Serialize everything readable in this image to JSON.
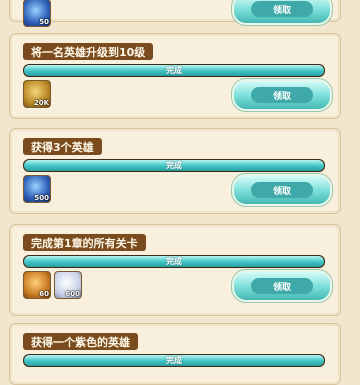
{
  "tasks": [
    {
      "title": "",
      "progress_label": "",
      "progress_fraction": 1.0,
      "button_label": "领取",
      "rewards": [
        {
          "icon": "blue-orb-icon",
          "count": "50"
        }
      ]
    },
    {
      "title": "将一名英雄升级到10级",
      "progress_label": "完成",
      "progress_fraction": 1.0,
      "button_label": "领取",
      "rewards": [
        {
          "icon": "gold-coin-icon",
          "count": "20K"
        }
      ]
    },
    {
      "title": "获得3个英雄",
      "progress_label": "完成",
      "progress_fraction": 1.0,
      "button_label": "领取",
      "rewards": [
        {
          "icon": "blue-orb-icon",
          "count": "500"
        }
      ]
    },
    {
      "title": "完成第1章的所有关卡",
      "progress_label": "完成",
      "progress_fraction": 1.0,
      "button_label": "领取",
      "rewards": [
        {
          "icon": "chest-icon",
          "count": "60"
        },
        {
          "icon": "white-crystal-icon",
          "count": "600"
        }
      ]
    },
    {
      "title": "获得一个紫色的英雄",
      "progress_label": "完成",
      "progress_fraction": 1.0,
      "button_label": "",
      "rewards": []
    }
  ]
}
